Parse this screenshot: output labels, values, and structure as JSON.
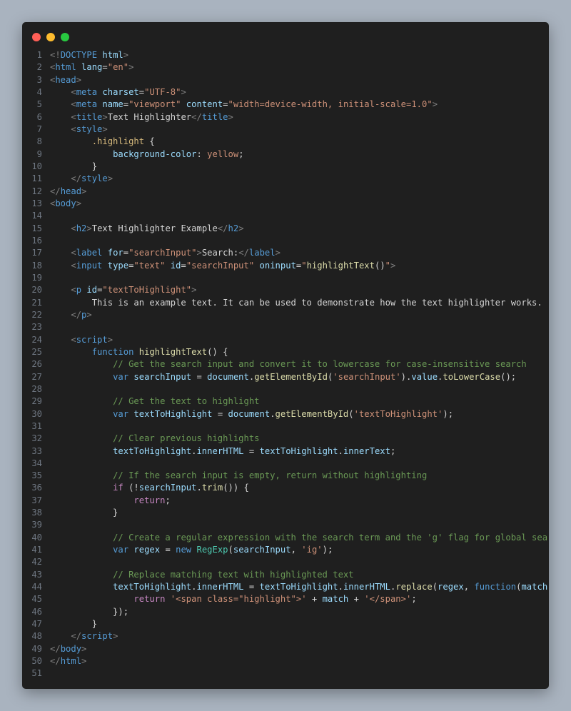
{
  "window": {
    "controls": [
      "close",
      "minimize",
      "maximize"
    ]
  },
  "colors": {
    "background": "#a9b3bf",
    "editor": "#1f1f1f",
    "close": "#ff5f57",
    "minimize": "#febc2e",
    "maximize": "#28c840"
  },
  "lines": [
    [
      [
        "t-bracket",
        "<!"
      ],
      [
        "t-tag",
        "DOCTYPE"
      ],
      [
        "t-attr",
        " html"
      ],
      [
        "t-bracket",
        ">"
      ]
    ],
    [
      [
        "t-bracket",
        "<"
      ],
      [
        "t-tag",
        "html"
      ],
      [
        "t-attr",
        " lang"
      ],
      [
        "t-plain",
        "="
      ],
      [
        "t-str",
        "\"en\""
      ],
      [
        "t-bracket",
        ">"
      ]
    ],
    [
      [
        "t-bracket",
        "<"
      ],
      [
        "t-tag",
        "head"
      ],
      [
        "t-bracket",
        ">"
      ]
    ],
    [
      [
        "t-plain",
        "    "
      ],
      [
        "t-bracket",
        "<"
      ],
      [
        "t-tag",
        "meta"
      ],
      [
        "t-attr",
        " charset"
      ],
      [
        "t-plain",
        "="
      ],
      [
        "t-str",
        "\"UTF-8\""
      ],
      [
        "t-bracket",
        ">"
      ]
    ],
    [
      [
        "t-plain",
        "    "
      ],
      [
        "t-bracket",
        "<"
      ],
      [
        "t-tag",
        "meta"
      ],
      [
        "t-attr",
        " name"
      ],
      [
        "t-plain",
        "="
      ],
      [
        "t-str",
        "\"viewport\""
      ],
      [
        "t-attr",
        " content"
      ],
      [
        "t-plain",
        "="
      ],
      [
        "t-str",
        "\"width=device-width, initial-scale=1.0\""
      ],
      [
        "t-bracket",
        ">"
      ]
    ],
    [
      [
        "t-plain",
        "    "
      ],
      [
        "t-bracket",
        "<"
      ],
      [
        "t-tag",
        "title"
      ],
      [
        "t-bracket",
        ">"
      ],
      [
        "t-text",
        "Text Highlighter"
      ],
      [
        "t-bracket",
        "</"
      ],
      [
        "t-tag",
        "title"
      ],
      [
        "t-bracket",
        ">"
      ]
    ],
    [
      [
        "t-plain",
        "    "
      ],
      [
        "t-bracket",
        "<"
      ],
      [
        "t-tag",
        "style"
      ],
      [
        "t-bracket",
        ">"
      ]
    ],
    [
      [
        "t-plain",
        "        "
      ],
      [
        "t-sel",
        ".highlight"
      ],
      [
        "t-plain",
        " {"
      ]
    ],
    [
      [
        "t-plain",
        "            "
      ],
      [
        "t-prop",
        "background-color"
      ],
      [
        "t-plain",
        ": "
      ],
      [
        "t-val",
        "yellow"
      ],
      [
        "t-plain",
        ";"
      ]
    ],
    [
      [
        "t-plain",
        "        }"
      ]
    ],
    [
      [
        "t-plain",
        "    "
      ],
      [
        "t-bracket",
        "</"
      ],
      [
        "t-tag",
        "style"
      ],
      [
        "t-bracket",
        ">"
      ]
    ],
    [
      [
        "t-bracket",
        "</"
      ],
      [
        "t-tag",
        "head"
      ],
      [
        "t-bracket",
        ">"
      ]
    ],
    [
      [
        "t-bracket",
        "<"
      ],
      [
        "t-tag",
        "body"
      ],
      [
        "t-bracket",
        ">"
      ]
    ],
    [],
    [
      [
        "t-plain",
        "    "
      ],
      [
        "t-bracket",
        "<"
      ],
      [
        "t-tag",
        "h2"
      ],
      [
        "t-bracket",
        ">"
      ],
      [
        "t-text",
        "Text Highlighter Example"
      ],
      [
        "t-bracket",
        "</"
      ],
      [
        "t-tag",
        "h2"
      ],
      [
        "t-bracket",
        ">"
      ]
    ],
    [],
    [
      [
        "t-plain",
        "    "
      ],
      [
        "t-bracket",
        "<"
      ],
      [
        "t-tag",
        "label"
      ],
      [
        "t-attr",
        " for"
      ],
      [
        "t-plain",
        "="
      ],
      [
        "t-str",
        "\"searchInput\""
      ],
      [
        "t-bracket",
        ">"
      ],
      [
        "t-text",
        "Search:"
      ],
      [
        "t-bracket",
        "</"
      ],
      [
        "t-tag",
        "label"
      ],
      [
        "t-bracket",
        ">"
      ]
    ],
    [
      [
        "t-plain",
        "    "
      ],
      [
        "t-bracket",
        "<"
      ],
      [
        "t-tag",
        "input"
      ],
      [
        "t-attr",
        " type"
      ],
      [
        "t-plain",
        "="
      ],
      [
        "t-str",
        "\"text\""
      ],
      [
        "t-attr",
        " id"
      ],
      [
        "t-plain",
        "="
      ],
      [
        "t-str",
        "\"searchInput\""
      ],
      [
        "t-attr",
        " oninput"
      ],
      [
        "t-plain",
        "="
      ],
      [
        "t-str",
        "\""
      ],
      [
        "t-fn",
        "highlightText"
      ],
      [
        "t-plain",
        "()"
      ],
      [
        "t-str",
        "\""
      ],
      [
        "t-bracket",
        ">"
      ]
    ],
    [],
    [
      [
        "t-plain",
        "    "
      ],
      [
        "t-bracket",
        "<"
      ],
      [
        "t-tag",
        "p"
      ],
      [
        "t-attr",
        " id"
      ],
      [
        "t-plain",
        "="
      ],
      [
        "t-str",
        "\"textToHighlight\""
      ],
      [
        "t-bracket",
        ">"
      ]
    ],
    [
      [
        "t-text",
        "        This is an example text. It can be used to demonstrate how the text highlighter works."
      ]
    ],
    [
      [
        "t-plain",
        "    "
      ],
      [
        "t-bracket",
        "</"
      ],
      [
        "t-tag",
        "p"
      ],
      [
        "t-bracket",
        ">"
      ]
    ],
    [],
    [
      [
        "t-plain",
        "    "
      ],
      [
        "t-bracket",
        "<"
      ],
      [
        "t-tag",
        "script"
      ],
      [
        "t-bracket",
        ">"
      ]
    ],
    [
      [
        "t-plain",
        "        "
      ],
      [
        "t-kw",
        "function"
      ],
      [
        "t-plain",
        " "
      ],
      [
        "t-fn",
        "highlightText"
      ],
      [
        "t-plain",
        "() {"
      ]
    ],
    [
      [
        "t-plain",
        "            "
      ],
      [
        "t-com",
        "// Get the search input and convert it to lowercase for case-insensitive search"
      ]
    ],
    [
      [
        "t-plain",
        "            "
      ],
      [
        "t-kw",
        "var"
      ],
      [
        "t-plain",
        " "
      ],
      [
        "t-var",
        "searchInput"
      ],
      [
        "t-plain",
        " = "
      ],
      [
        "t-var",
        "document"
      ],
      [
        "t-plain",
        "."
      ],
      [
        "t-fn",
        "getElementById"
      ],
      [
        "t-plain",
        "("
      ],
      [
        "t-str",
        "'searchInput'"
      ],
      [
        "t-plain",
        ")."
      ],
      [
        "t-var",
        "value"
      ],
      [
        "t-plain",
        "."
      ],
      [
        "t-fn",
        "toLowerCase"
      ],
      [
        "t-plain",
        "();"
      ]
    ],
    [],
    [
      [
        "t-plain",
        "            "
      ],
      [
        "t-com",
        "// Get the text to highlight"
      ]
    ],
    [
      [
        "t-plain",
        "            "
      ],
      [
        "t-kw",
        "var"
      ],
      [
        "t-plain",
        " "
      ],
      [
        "t-var",
        "textToHighlight"
      ],
      [
        "t-plain",
        " = "
      ],
      [
        "t-var",
        "document"
      ],
      [
        "t-plain",
        "."
      ],
      [
        "t-fn",
        "getElementById"
      ],
      [
        "t-plain",
        "("
      ],
      [
        "t-str",
        "'textToHighlight'"
      ],
      [
        "t-plain",
        ");"
      ]
    ],
    [],
    [
      [
        "t-plain",
        "            "
      ],
      [
        "t-com",
        "// Clear previous highlights"
      ]
    ],
    [
      [
        "t-plain",
        "            "
      ],
      [
        "t-var",
        "textToHighlight"
      ],
      [
        "t-plain",
        "."
      ],
      [
        "t-var",
        "innerHTML"
      ],
      [
        "t-plain",
        " = "
      ],
      [
        "t-var",
        "textToHighlight"
      ],
      [
        "t-plain",
        "."
      ],
      [
        "t-var",
        "innerText"
      ],
      [
        "t-plain",
        ";"
      ]
    ],
    [],
    [
      [
        "t-plain",
        "            "
      ],
      [
        "t-com",
        "// If the search input is empty, return without highlighting"
      ]
    ],
    [
      [
        "t-plain",
        "            "
      ],
      [
        "t-ctl",
        "if"
      ],
      [
        "t-plain",
        " (!"
      ],
      [
        "t-var",
        "searchInput"
      ],
      [
        "t-plain",
        "."
      ],
      [
        "t-fn",
        "trim"
      ],
      [
        "t-plain",
        "()) {"
      ]
    ],
    [
      [
        "t-plain",
        "                "
      ],
      [
        "t-ctl",
        "return"
      ],
      [
        "t-plain",
        ";"
      ]
    ],
    [
      [
        "t-plain",
        "            }"
      ]
    ],
    [],
    [
      [
        "t-plain",
        "            "
      ],
      [
        "t-com",
        "// Create a regular expression with the search term and the 'g' flag for global search"
      ]
    ],
    [
      [
        "t-plain",
        "            "
      ],
      [
        "t-kw",
        "var"
      ],
      [
        "t-plain",
        " "
      ],
      [
        "t-var",
        "regex"
      ],
      [
        "t-plain",
        " = "
      ],
      [
        "t-kw",
        "new"
      ],
      [
        "t-plain",
        " "
      ],
      [
        "t-cls",
        "RegExp"
      ],
      [
        "t-plain",
        "("
      ],
      [
        "t-var",
        "searchInput"
      ],
      [
        "t-plain",
        ", "
      ],
      [
        "t-str",
        "'ig'"
      ],
      [
        "t-plain",
        ");"
      ]
    ],
    [],
    [
      [
        "t-plain",
        "            "
      ],
      [
        "t-com",
        "// Replace matching text with highlighted text"
      ]
    ],
    [
      [
        "t-plain",
        "            "
      ],
      [
        "t-var",
        "textToHighlight"
      ],
      [
        "t-plain",
        "."
      ],
      [
        "t-var",
        "innerHTML"
      ],
      [
        "t-plain",
        " = "
      ],
      [
        "t-var",
        "textToHighlight"
      ],
      [
        "t-plain",
        "."
      ],
      [
        "t-var",
        "innerHTML"
      ],
      [
        "t-plain",
        "."
      ],
      [
        "t-fn",
        "replace"
      ],
      [
        "t-plain",
        "("
      ],
      [
        "t-var",
        "regex"
      ],
      [
        "t-plain",
        ", "
      ],
      [
        "t-kw",
        "function"
      ],
      [
        "t-plain",
        "("
      ],
      [
        "t-var",
        "match"
      ],
      [
        "t-plain",
        ") {"
      ]
    ],
    [
      [
        "t-plain",
        "                "
      ],
      [
        "t-ctl",
        "return"
      ],
      [
        "t-plain",
        " "
      ],
      [
        "t-str",
        "'<span class=\"highlight\">'"
      ],
      [
        "t-plain",
        " + "
      ],
      [
        "t-var",
        "match"
      ],
      [
        "t-plain",
        " + "
      ],
      [
        "t-str",
        "'</span>'"
      ],
      [
        "t-plain",
        ";"
      ]
    ],
    [
      [
        "t-plain",
        "            });"
      ]
    ],
    [
      [
        "t-plain",
        "        }"
      ]
    ],
    [
      [
        "t-plain",
        "    "
      ],
      [
        "t-bracket",
        "</"
      ],
      [
        "t-tag",
        "script"
      ],
      [
        "t-bracket",
        ">"
      ]
    ],
    [
      [
        "t-bracket",
        "</"
      ],
      [
        "t-tag",
        "body"
      ],
      [
        "t-bracket",
        ">"
      ]
    ],
    [
      [
        "t-bracket",
        "</"
      ],
      [
        "t-tag",
        "html"
      ],
      [
        "t-bracket",
        ">"
      ]
    ],
    []
  ]
}
